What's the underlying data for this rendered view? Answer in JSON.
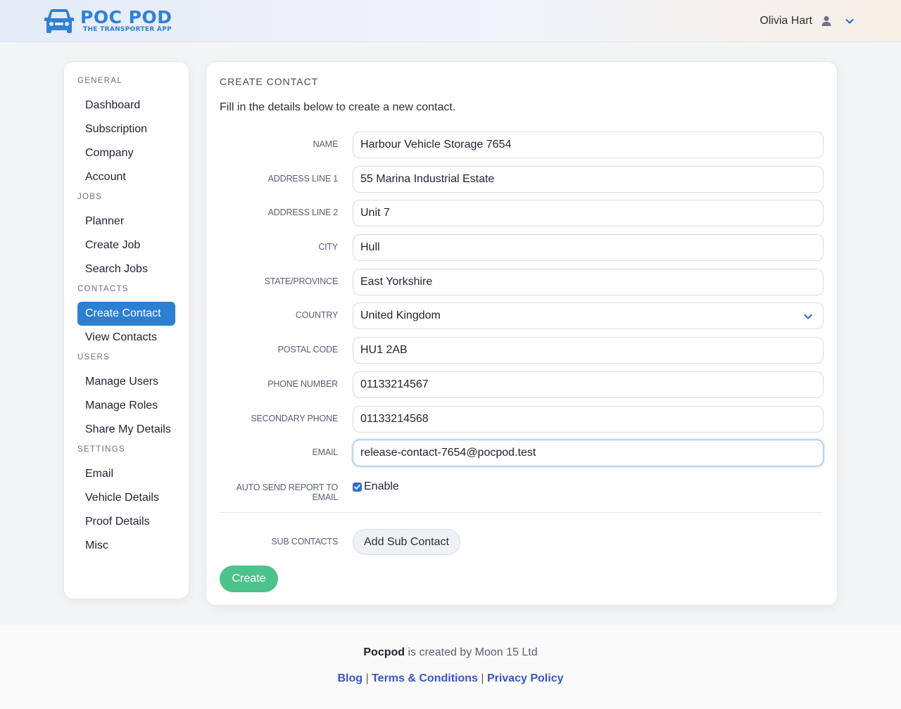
{
  "header": {
    "logo_title": "POC POD",
    "logo_subtitle": "THE TRANSPORTER APP",
    "logo_icon": "car-icon",
    "user_name": "Olivia Hart",
    "user_icon": "user-icon",
    "caret_icon": "chevron-down-icon",
    "accent_color": "#2f80d6"
  },
  "sidebar": {
    "sections": [
      {
        "title": "GENERAL",
        "items": [
          "Dashboard",
          "Subscription",
          "Company",
          "Account"
        ]
      },
      {
        "title": "JOBS",
        "items": [
          "Planner",
          "Create Job",
          "Search Jobs"
        ]
      },
      {
        "title": "CONTACTS",
        "items": [
          "Create Contact",
          "View Contacts"
        ]
      },
      {
        "title": "USERS",
        "items": [
          "Manage Users",
          "Manage Roles",
          "Share My Details"
        ]
      },
      {
        "title": "SETTINGS",
        "items": [
          "Email",
          "Vehicle Details",
          "Proof Details",
          "Misc"
        ]
      }
    ],
    "active_item": "Create Contact",
    "active_color": "#2c7fd3"
  },
  "main": {
    "title": "CREATE CONTACT",
    "description": "Fill in the details below to create a new contact.",
    "fields": [
      {
        "label": "NAME",
        "value": "Harbour Vehicle Storage 7654"
      },
      {
        "label": "ADDRESS LINE 1",
        "value": "55 Marina Industrial Estate"
      },
      {
        "label": "ADDRESS LINE 2",
        "value": "Unit 7"
      },
      {
        "label": "CITY",
        "value": "Hull"
      },
      {
        "label": "STATE/PROVINCE",
        "value": "East Yorkshire"
      },
      {
        "label": "COUNTRY",
        "value": "United Kingdom"
      },
      {
        "label": "POSTAL CODE",
        "value": "HU1 2AB"
      },
      {
        "label": "PHONE NUMBER",
        "value": "01133214567"
      },
      {
        "label": "SECONDARY PHONE",
        "value": "01133214568"
      },
      {
        "label": "EMAIL",
        "value": "release-contact-7654@pocpod.test"
      }
    ],
    "auto_send": {
      "label": "AUTO SEND REPORT TO EMAIL",
      "checkbox_label": "Enable",
      "checked": true
    },
    "sub_contacts": {
      "label": "SUB CONTACTS",
      "button_label": "Add Sub Contact"
    },
    "create_label": "Create",
    "create_color": "#4cc38a"
  },
  "footer": {
    "brand": "Pocpod",
    "created_by": " is created by Moon 15 Ltd",
    "links": [
      "Blog",
      "Terms & Conditions",
      "Privacy Policy"
    ],
    "separator": " | "
  }
}
